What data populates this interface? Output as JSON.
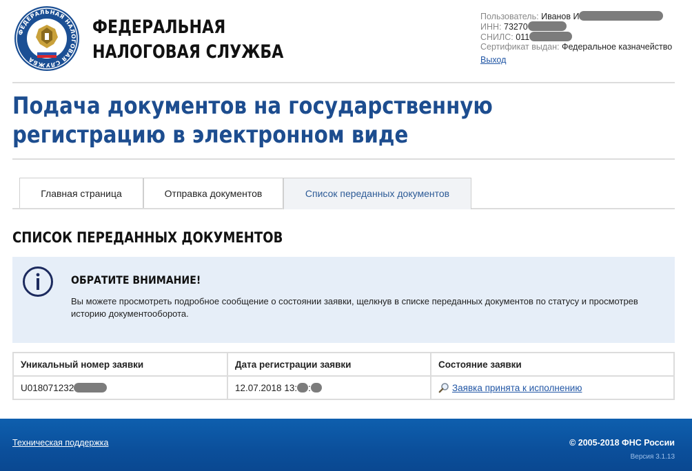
{
  "header": {
    "logo_ring_text": "ФЕДЕРАЛЬНАЯ НАЛОГОВАЯ СЛУЖБА",
    "brand_line1": "ФЕДЕРАЛЬНАЯ",
    "brand_line2": "НАЛОГОВАЯ СЛУЖБА"
  },
  "user": {
    "user_label": "Пользователь:",
    "user_value": "Иванов И",
    "inn_label": "ИНН:",
    "inn_value": "73270",
    "snils_label": "СНИЛС:",
    "snils_value": "011",
    "cert_label": "Сертификат выдан:",
    "cert_value": "Федеральное казначейство",
    "logout": "Выход"
  },
  "page_title": "Подача документов на государственную регистрацию в электронном виде",
  "tabs": [
    {
      "label": "Главная страница"
    },
    {
      "label": "Отправка документов"
    },
    {
      "label": "Список переданных документов"
    }
  ],
  "section_title": "СПИСОК ПЕРЕДАННЫХ ДОКУМЕНТОВ",
  "notice": {
    "icon": "info-icon",
    "heading": "ОБРАТИТЕ ВНИМАНИЕ!",
    "text": "Вы можете просмотреть подробное сообщение о состоянии заявки, щелкнув в списке переданных документов по статусу и просмотрев историю документооборота."
  },
  "table": {
    "headers": [
      "Уникальный номер заявки",
      "Дата регистрации заявки",
      "Состояние заявки"
    ],
    "rows": [
      {
        "number": "U018071232",
        "date": "12.07.2018 13:",
        "time_sep": ":",
        "status": "Заявка принята к исполнению",
        "status_icon": "magnifier-icon"
      }
    ]
  },
  "footer": {
    "support_link": "Техническая поддержка",
    "copyright": "© 2005-2018 ФНС России",
    "version": "Версия 3.1.13"
  },
  "colors": {
    "title": "#1d4d8f",
    "link": "#2156a5",
    "notice_bg": "#e6eef8",
    "footer_bg": "#0b4f9b"
  }
}
